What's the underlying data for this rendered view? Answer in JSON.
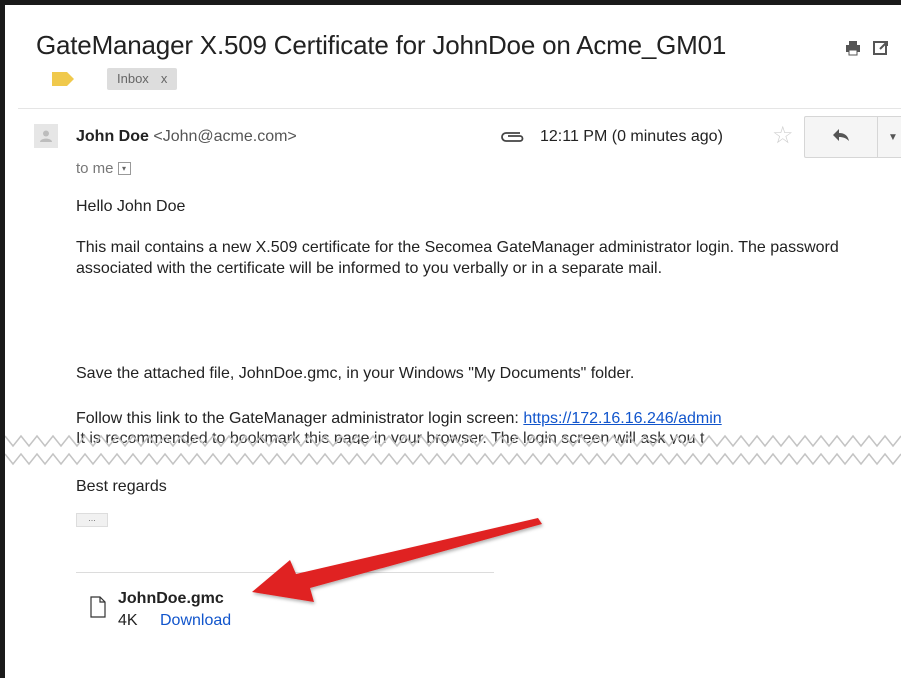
{
  "email": {
    "subject": "GateManager X.509 Certificate for JohnDoe on Acme_GM01",
    "label_chip": "Inbox",
    "label_chip_close": "x",
    "sender_name": "John Doe",
    "sender_email": "<John@acme.com>",
    "recipient": "to me",
    "timestamp": "12:11 PM (0 minutes ago)",
    "body": {
      "greeting": "Hello John Doe",
      "paragraph1": "This mail contains a new X.509 certificate for the Secomea GateManager administrator login. The password associated with the certificate will be informed to you verbally or in a separate mail.",
      "paragraph2": "Save the attached file, JohnDoe.gmc, in your Windows \"My Documents\" folder.",
      "link_intro": "Follow this link to the GateManager administrator login screen: ",
      "link": "https://172.16.16.246/admin",
      "partial_line": "It is recommended to bookmark this page in your browser. The login screen will ask you t",
      "closing": "Best regards",
      "collapsed_quote": "..."
    },
    "attachment": {
      "filename": "JohnDoe.gmc",
      "size": "4K",
      "download_label": "Download"
    }
  },
  "icons": {
    "print": "print-icon",
    "new_window": "new-window-icon",
    "label": "label-tag-icon",
    "attachment": "paperclip-icon",
    "star": "star-icon",
    "reply": "reply-icon",
    "more": "chevron-down-icon",
    "avatar": "avatar-icon",
    "file": "file-icon"
  },
  "colors": {
    "link": "#1155cc",
    "label_tag": "#f0c94c",
    "annotation_arrow": "#e02020"
  }
}
